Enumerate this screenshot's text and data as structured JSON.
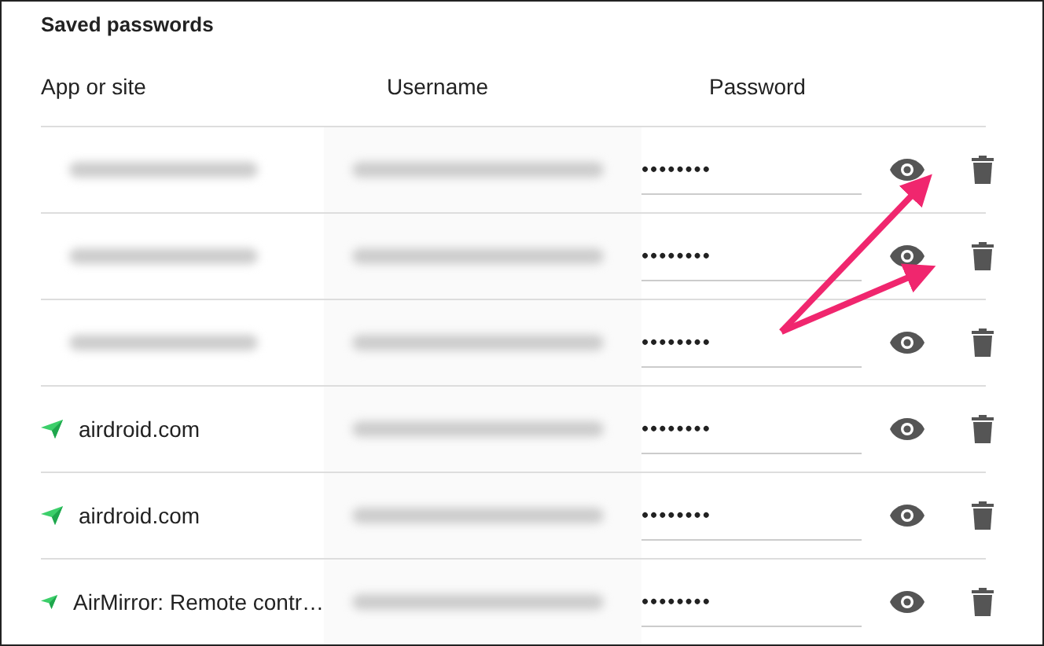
{
  "title": "Saved passwords",
  "columns": [
    "App or site",
    "Username",
    "Password"
  ],
  "rows": [
    {
      "kind": "redacted",
      "password": "••••••••"
    },
    {
      "kind": "redacted",
      "password": "••••••••"
    },
    {
      "kind": "redacted",
      "password": "••••••••"
    },
    {
      "kind": "site",
      "site": "airdroid.com",
      "password": "••••••••"
    },
    {
      "kind": "site",
      "site": "airdroid.com",
      "password": "••••••••"
    },
    {
      "kind": "site",
      "site": "AirMirror: Remote contr…",
      "password": "••••••••"
    }
  ],
  "annotations": [
    {
      "kind": "arrow"
    },
    {
      "kind": "arrow"
    }
  ]
}
